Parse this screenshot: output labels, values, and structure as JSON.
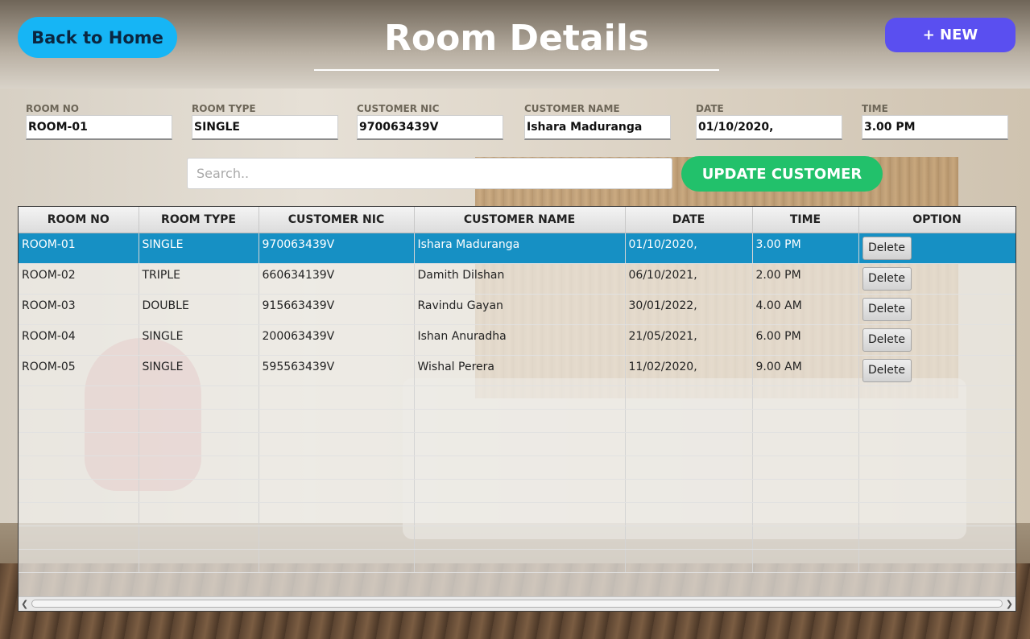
{
  "header": {
    "title": "Room Details"
  },
  "nav": {
    "back_label": "Back to Home",
    "new_label": "+ NEW"
  },
  "form": {
    "fields": [
      {
        "label": "ROOM NO",
        "value": "ROOM-01"
      },
      {
        "label": "ROOM TYPE",
        "value": "SINGLE"
      },
      {
        "label": "CUSTOMER NIC",
        "value": "970063439V"
      },
      {
        "label": "CUSTOMER NAME",
        "value": "Ishara Maduranga"
      },
      {
        "label": "DATE",
        "value": "01/10/2020,"
      },
      {
        "label": "TIME",
        "value": "3.00 PM"
      }
    ]
  },
  "search": {
    "placeholder": "Search..",
    "update_label": "UPDATE CUSTOMER"
  },
  "table": {
    "columns": [
      "ROOM NO",
      "ROOM TYPE",
      "CUSTOMER NIC",
      "CUSTOMER NAME",
      "DATE",
      "TIME",
      "OPTION"
    ],
    "rows": [
      [
        "ROOM-01",
        "SINGLE",
        "970063439V",
        "Ishara Maduranga",
        "01/10/2020,",
        "3.00 PM"
      ],
      [
        "ROOM-02",
        "TRIPLE",
        "660634139V",
        "Damith Dilshan",
        "06/10/2021,",
        "2.00 PM"
      ],
      [
        "ROOM-03",
        "DOUBLE",
        "915663439V",
        "Ravindu Gayan",
        "30/01/2022,",
        "4.00 AM"
      ],
      [
        "ROOM-04",
        "SINGLE",
        "200063439V",
        "Ishan Anuradha",
        "21/05/2021,",
        "6.00 PM"
      ],
      [
        "ROOM-05",
        "SINGLE",
        "595563439V",
        "Wishal Perera",
        "11/02/2020,",
        "9.00 AM"
      ]
    ],
    "delete_label": "Delete",
    "selected_row": 0
  },
  "colors": {
    "home_button": "#16b5f5",
    "new_button": "#5a4ff0",
    "update_button": "#22c16b",
    "selected_row": "#1690c4"
  },
  "icons": {
    "scroll_left": "chevron-left-icon",
    "scroll_right": "chevron-right-icon"
  }
}
